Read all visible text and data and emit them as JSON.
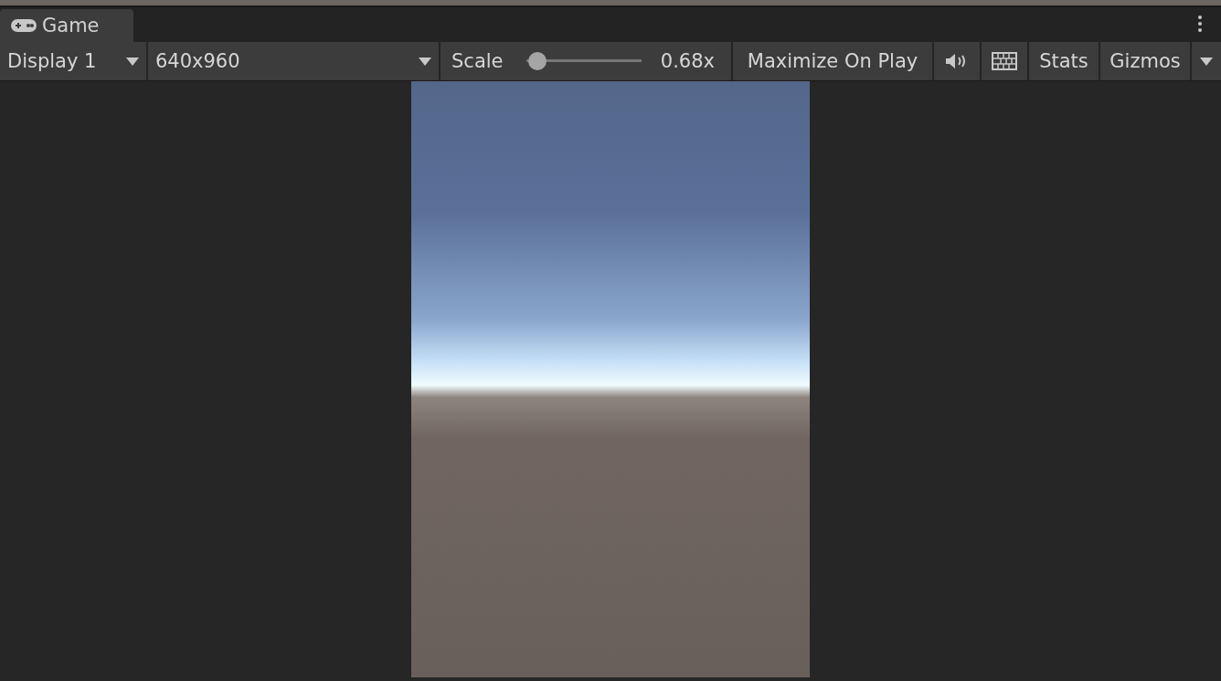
{
  "tab": {
    "title": "Game",
    "selected": true
  },
  "toolbar": {
    "display": "Display 1",
    "resolution": "640x960",
    "scale": {
      "label": "Scale",
      "level": 0.02,
      "reading": "0.68x"
    },
    "maximize": "Maximize On Play",
    "stats": "Stats",
    "gizmos": "Gizmos"
  }
}
